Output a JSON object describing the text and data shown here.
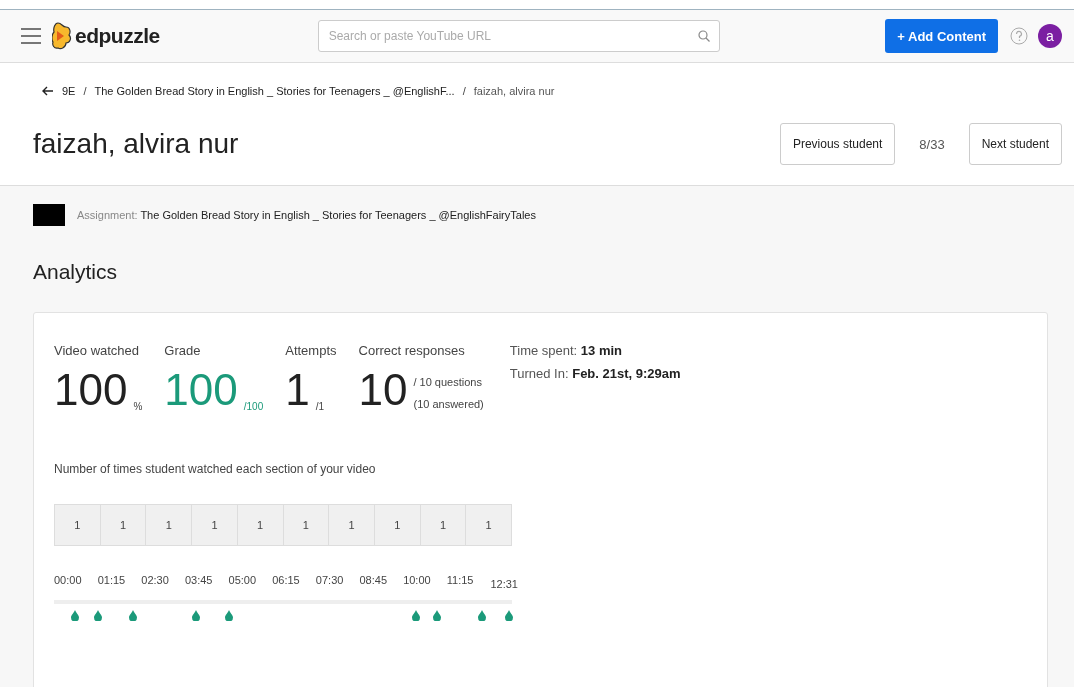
{
  "header": {
    "logo_text": "edpuzzle",
    "search": {
      "placeholder": "Search or paste YouTube URL"
    },
    "add_button": "+ Add Content",
    "avatar": "a"
  },
  "breadcrumb_separator": "/",
  "breadcrumb": [
    "9E",
    "The Golden Bread Story in English _ Stories for Teenagers _ @EnglishF...",
    "faizah, alvira nur"
  ],
  "student": {
    "name": "faizah, alvira nur",
    "previous": "Previous student",
    "position": "8/33",
    "next": "Next student"
  },
  "assignment": {
    "label": "Assignment:",
    "title": "The Golden Bread Story in English _ Stories for Teenagers _ @EnglishFairyTales"
  },
  "analytics_title": "Analytics",
  "stats": [
    {
      "label": "Video watched",
      "value": "100",
      "suffix": "%",
      "kind": "plain"
    },
    {
      "label": "Grade",
      "value": "100",
      "suffix": "/100",
      "kind": "grade"
    },
    {
      "label": "Attempts",
      "value": "1",
      "suffix": "/1",
      "kind": "plain"
    },
    {
      "label": "Correct responses",
      "value": "10",
      "suffix": "/ 10 questions",
      "note": "(10 answered)",
      "kind": "plain"
    }
  ],
  "details": [
    {
      "label": "Time spent:",
      "value": "13 min"
    },
    {
      "label": "Turned In:",
      "value": "Feb. 21st, 9:29am"
    }
  ],
  "watch_title": "Number of times student watched each section of your video",
  "sections": [
    "1",
    "1",
    "1",
    "1",
    "1",
    "1",
    "1",
    "1",
    "1",
    "1"
  ],
  "times": [
    "00:00",
    "01:15",
    "02:30",
    "03:45",
    "05:00",
    "06:15",
    "07:30",
    "08:45",
    "10:00",
    "11:15",
    "12:31"
  ],
  "markers": [
    {
      "level": 0.046
    },
    {
      "level": 0.096
    },
    {
      "level": 0.172
    },
    {
      "level": 0.31
    },
    {
      "level": 0.382
    },
    {
      "level": 0.79
    },
    {
      "level": 0.836
    },
    {
      "level": 0.934
    },
    {
      "level": 0.993
    }
  ]
}
